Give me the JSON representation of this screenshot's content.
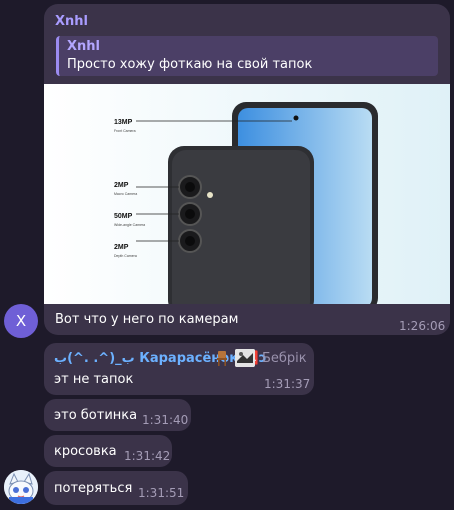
{
  "messages": [
    {
      "sender": "Xnhl",
      "reply": {
        "name": "Xnhl",
        "text": "Просто хожу фоткаю на свой тапок"
      },
      "photo": {
        "labels": [
          {
            "title": "13MP",
            "sub": "Front Camera"
          },
          {
            "title": "2MP",
            "sub": "Macro Camera"
          },
          {
            "title": "50MP",
            "sub": "Wide-angle Camera"
          },
          {
            "title": "2MP",
            "sub": "Depth Camera"
          }
        ]
      },
      "text": "Вот что у него по камерам",
      "time": "1:26:06",
      "avatar_letter": "X"
    },
    {
      "sender": "ب_(^. .^)ب Карарасёнок 🆑ɔ",
      "tag": "Бебрік",
      "text": "эт не тапок",
      "time": "1:31:37"
    },
    {
      "text": "это ботинка",
      "time": "1:31:40"
    },
    {
      "text": "кросовка",
      "time": "1:31:42"
    },
    {
      "text": "потеряться",
      "time": "1:31:51"
    }
  ],
  "colors": {
    "background": "#1e1a2a",
    "bubble": "#3b3349",
    "sender_purple": "#a99cff",
    "sender_blue": "#6cb1ff",
    "timestamp": "#a49cb6"
  }
}
